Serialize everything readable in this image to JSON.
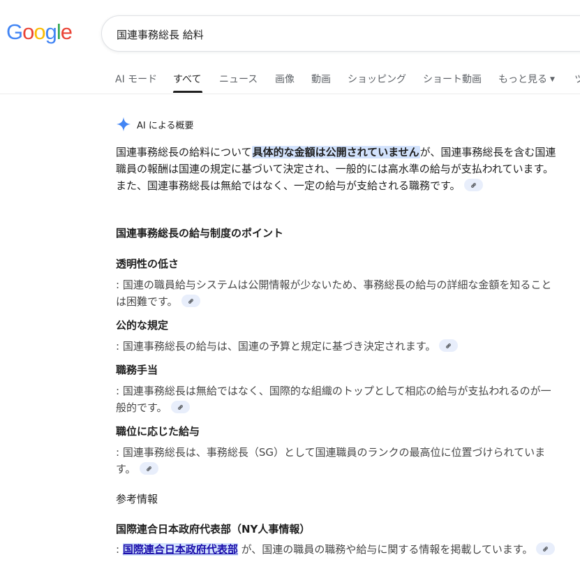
{
  "logo": {
    "letters": [
      "G",
      "o",
      "o",
      "g",
      "l",
      "e"
    ],
    "colors": [
      "#4285F4",
      "#EA4335",
      "#FBBC05",
      "#4285F4",
      "#34A853",
      "#EA4335"
    ]
  },
  "search": {
    "value": "国連事務総長 給料"
  },
  "tabs": [
    {
      "label": "AI モード"
    },
    {
      "label": "すべて",
      "active": true
    },
    {
      "label": "ニュース"
    },
    {
      "label": "画像"
    },
    {
      "label": "動画"
    },
    {
      "label": "ショッピング"
    },
    {
      "label": "ショート動画"
    },
    {
      "label": "もっと見る"
    },
    {
      "label": "ツ"
    }
  ],
  "ai_overview": {
    "label": "AI による概要",
    "accent": "#4285F4",
    "intro_before": "国連事務総長の給料について",
    "intro_highlight": "具体的な金額は公開されていません",
    "intro_after": "が、国連事務総長を含む国連職員の報酬は国連の規定に基づいて決定され、一般的には高水準の給与が支払われています。また、国連事務総長は無給ではなく、一定の給与が支給される職務です。",
    "points_heading": "国連事務総長の給与制度のポイント",
    "points": [
      {
        "title": "透明性の低さ",
        "desc": ": 国連の職員給与システムは公開情報が少ないため、事務総長の給与の詳細な金額を知ることは困難です。"
      },
      {
        "title": "公的な規定",
        "desc": ": 国連事務総長の給与は、国連の予算と規定に基づき決定されます。"
      },
      {
        "title": "職務手当",
        "desc": ": 国連事務総長は無給ではなく、国際的な組織のトップとして相応の給与が支払われるのが一般的です。"
      },
      {
        "title": "職位に応じた給与",
        "desc": ": 国連事務総長は、事務総長（SG）として国連職員のランクの最高位に位置づけられています。"
      }
    ],
    "ref_label": "参考情報",
    "ref_title": "国際連合日本政府代表部（NY人事情報）",
    "ref_prefix": ": ",
    "ref_link": "国際連合日本政府代表部",
    "ref_after": " が、国連の職員の職務や給与に関する情報を掲載しています。"
  }
}
